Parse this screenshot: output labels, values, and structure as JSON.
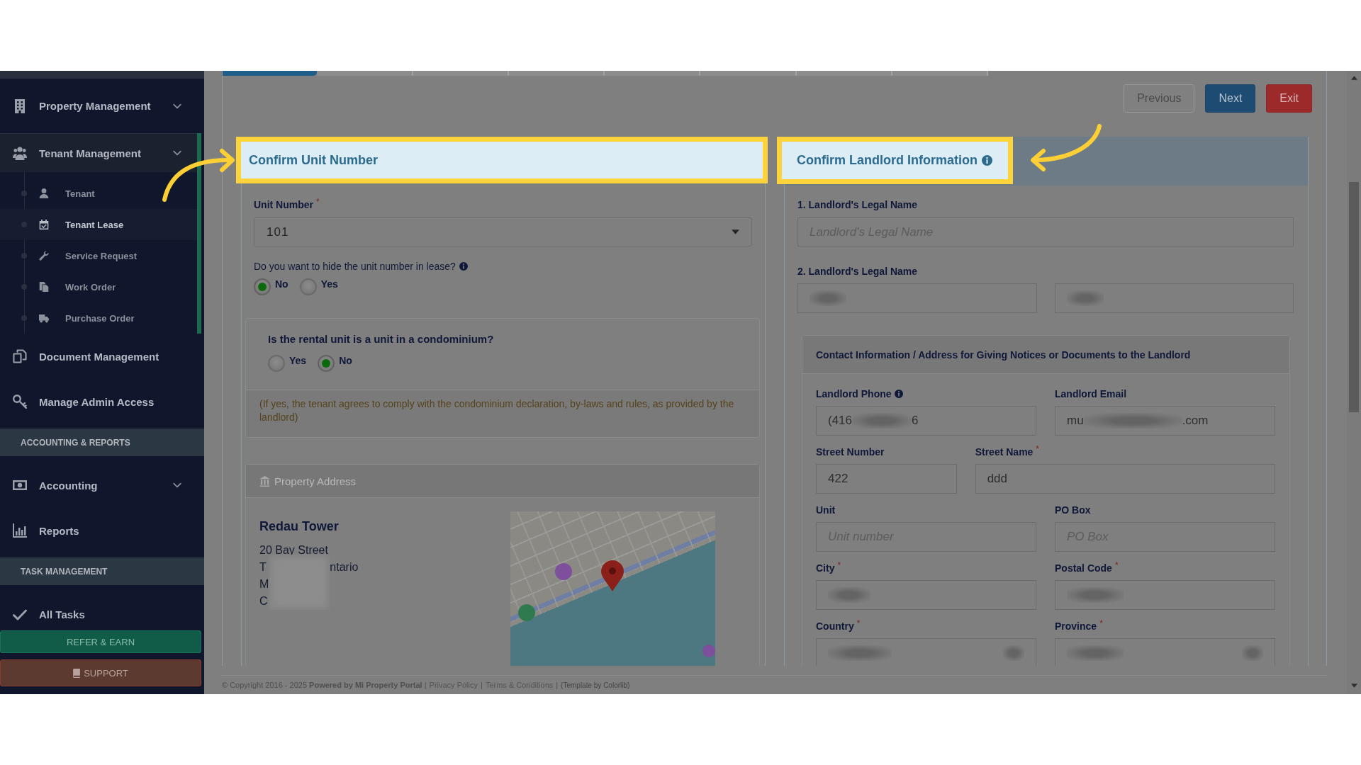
{
  "wizard_steps": [
    {
      "selected": true
    },
    {
      "selected": false
    },
    {
      "selected": false
    },
    {
      "selected": false
    },
    {
      "selected": false
    },
    {
      "selected": false
    },
    {
      "selected": false
    },
    {
      "selected": false
    }
  ],
  "sidebar": {
    "items": [
      {
        "kind": "dropdown",
        "label": "Property Management",
        "expanded": false
      },
      {
        "kind": "dropdown",
        "label": "Tenant Management",
        "expanded": true,
        "children": [
          {
            "label": "Tenant",
            "selected": false
          },
          {
            "label": "Tenant Lease",
            "selected": true
          },
          {
            "label": "Service Request",
            "selected": false
          },
          {
            "label": "Work Order",
            "selected": false
          },
          {
            "label": "Purchase Order",
            "selected": false
          }
        ]
      },
      {
        "kind": "link",
        "label": "Document Management"
      },
      {
        "kind": "link",
        "label": "Manage Admin Access"
      },
      {
        "kind": "heading",
        "label": "ACCOUNTING & REPORTS"
      },
      {
        "kind": "dropdown",
        "label": "Accounting",
        "expanded": false
      },
      {
        "kind": "link",
        "label": "Reports"
      },
      {
        "kind": "heading",
        "label": "TASK MANAGEMENT"
      },
      {
        "kind": "link",
        "label": "All Tasks"
      }
    ],
    "buttons": [
      {
        "kind": "refer",
        "label": "REFER & EARN"
      },
      {
        "kind": "support",
        "label": "SUPPORT"
      }
    ]
  },
  "toolbar": {
    "buttons": [
      {
        "kind": "secondary",
        "label": "Previous"
      },
      {
        "kind": "primary",
        "label": "Next"
      },
      {
        "kind": "danger",
        "label": "Exit"
      }
    ]
  },
  "unit_section": {
    "title": "Confirm Unit Number",
    "highlighted": true,
    "unit_number": {
      "label": "Unit Number",
      "required_mark": "*",
      "value": "101"
    },
    "hide_unit": {
      "question": "Do you want to hide the unit number in lease?",
      "info": true,
      "options": [
        {
          "label": "No",
          "selected": true
        },
        {
          "label": "Yes",
          "selected": false
        }
      ]
    },
    "condo": {
      "question": "Is the rental unit is a unit in a condominium?",
      "options": [
        {
          "label": "Yes",
          "selected": false
        },
        {
          "label": "No",
          "selected": true
        }
      ],
      "note": "(If yes, the tenant agrees to comply with the condominium declaration, by-laws and rules, as provided by the landlord)"
    },
    "property_address": {
      "title": "Property Address",
      "name": "Redau Tower",
      "street": "20 Bay Street",
      "redacted": true,
      "partial_lines": [
        {
          "lead": "T",
          "tail": "ntario"
        },
        {
          "lead": "M"
        },
        {
          "lead": "C"
        }
      ]
    }
  },
  "landlord_section": {
    "title": "Confirm Landlord Information",
    "highlighted": true,
    "info": true,
    "legal_name_1": {
      "label": "1. Landlord's Legal Name",
      "placeholder": "Landlord's Legal Name"
    },
    "legal_name_2": {
      "label": "2. Landlord's Legal Name",
      "fields": [
        {
          "redacted": true
        },
        {
          "redacted": true
        }
      ]
    },
    "contact": {
      "title": "Contact Information / Address for Giving Notices or Documents to the Landlord",
      "fields": [
        {
          "kind": "input",
          "label": "Landlord Phone",
          "info": true,
          "value_lead": "(416",
          "value_tail": "6",
          "redacted": true
        },
        {
          "kind": "input",
          "label": "Landlord Email",
          "value_lead": "mu",
          "value_tail": ".com",
          "redacted": true
        },
        {
          "kind": "input",
          "label": "Street Number",
          "value": "422"
        },
        {
          "kind": "input",
          "label": "Street Name",
          "required_mark": "*",
          "value": "ddd"
        },
        {
          "kind": "input",
          "label": "Unit",
          "placeholder": "Unit number"
        },
        {
          "kind": "input",
          "label": "PO Box",
          "placeholder": "PO Box"
        },
        {
          "kind": "input",
          "label": "City",
          "required_mark": "*",
          "redacted": true
        },
        {
          "kind": "input",
          "label": "Postal Code",
          "required_mark": "*",
          "redacted": true
        },
        {
          "kind": "select",
          "label": "Country",
          "required_mark": "*",
          "redacted": true
        },
        {
          "kind": "select",
          "label": "Province",
          "required_mark": "*",
          "redacted": true
        }
      ]
    }
  },
  "footer": {
    "parts": [
      {
        "kind": "text",
        "text": "© Copyright 2016 - 2025 **Powered by Mi Property Portal** |"
      },
      {
        "kind": "link",
        "text": "Privacy Policy"
      },
      {
        "kind": "text",
        "text": "|"
      },
      {
        "kind": "link",
        "text": "Terms & Conditions"
      },
      {
        "kind": "text",
        "text": "|"
      },
      {
        "kind": "credit",
        "text": "(Template by Colorlib)"
      }
    ]
  }
}
